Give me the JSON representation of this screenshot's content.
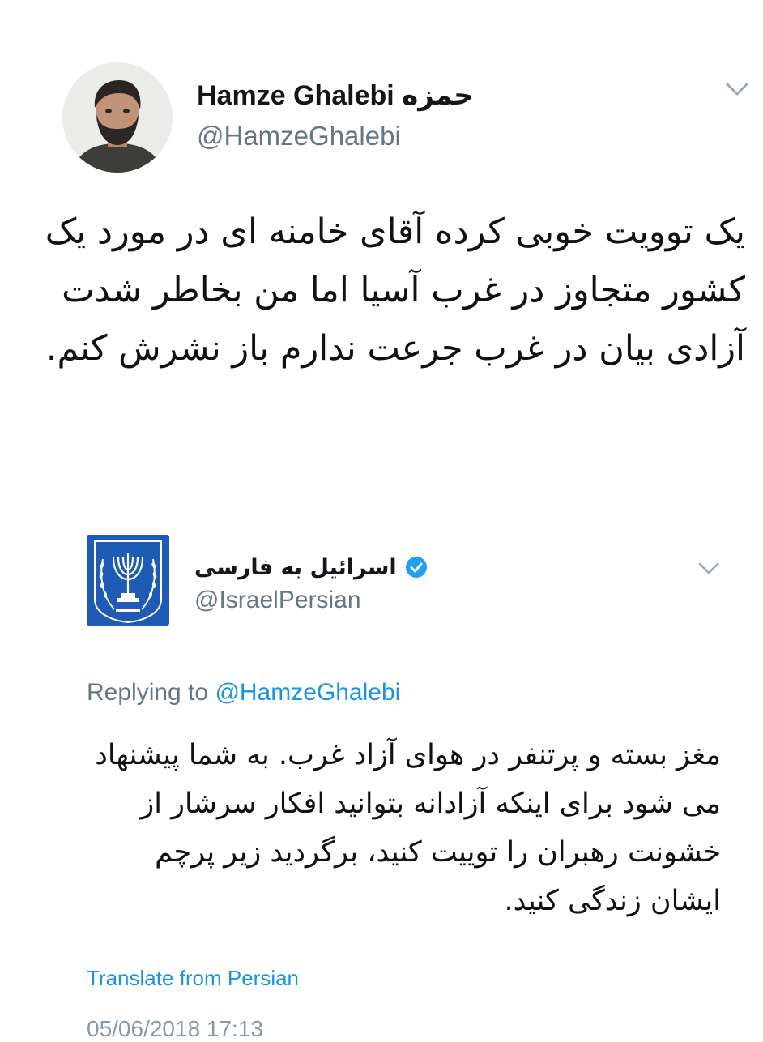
{
  "tweet1": {
    "display_name": "Hamze Ghalebi حمزه",
    "handle": "@HamzeGhalebi",
    "text": "یک توویت خوبی کرده آقای خامنه ای در مورد یک کشور متجاوز در غرب آسیا اما من بخاطر شدت آزادی بیان در غرب جرعت ندارم باز نشرش کنم.",
    "menu_icon": "chevron-down-icon"
  },
  "tweet2": {
    "display_name": "اسرائیل به فارسی",
    "handle": "@IsraelPersian",
    "verified": true,
    "avatar_icon": "israel-emblem-icon",
    "menu_icon": "chevron-down-icon",
    "replying_prefix": "Replying to",
    "replying_to": "@HamzeGhalebi",
    "text": "مغز بسته و پرتنفر در هوای آزاد غرب. به شما پیشنهاد می شود برای اینکه آزادانه بتوانید افکار سرشار از خشونت رهبران را توییت کنید، برگردید زیر پرچم ایشان زندگی کنید.",
    "translate_label": "Translate from Persian",
    "timestamp": "05/06/2018 17:13"
  },
  "colors": {
    "secondary_text": "#657786",
    "link": "#1b95e0",
    "emblem_blue": "#1d5bb5",
    "verified_blue": "#1da1f2"
  }
}
